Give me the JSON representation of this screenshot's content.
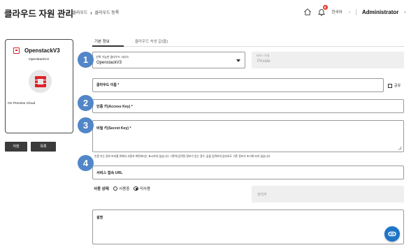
{
  "header": {
    "title": "클라우드 자원 관리",
    "breadcrumb": [
      "클라우드",
      "클라우드 등록"
    ],
    "notification_count": "6",
    "language": "한국어",
    "user": "Administrator",
    "icons": [
      "home-icon",
      "bell-icon",
      "chevron-down-icon"
    ]
  },
  "card": {
    "title": "OpenstackV3",
    "subtitle": "OpenstackV3",
    "type": "On Premise Cloud",
    "logo": "openstack-logo"
  },
  "actions": {
    "save": "저장",
    "list": "목록"
  },
  "tabs": [
    {
      "label": "기본 정보",
      "active": true
    },
    {
      "label": "클라우드 속성 값(들)",
      "active": false
    }
  ],
  "form": {
    "service_label": "선택 가능한 클라우드 서비스",
    "service_value": "OpenstackV3",
    "service_type_label": "서비스 유형",
    "service_type_value": "Private",
    "cloud_name_label": "클라우드 이름 *",
    "share_label": "공유",
    "access_key_label": "인증 키(Access Key) *",
    "secret_key_label": "비밀 키(Secret Key) *",
    "key_hint": "인증 키는 정보 보호를 위해서 사용자 화면에서는 표시하지 않습니다. 기존에 입력된 정보가 있는 경우, 값을 입력하지 않더라도 기존 정보가 초기화 되지 않습니다.",
    "service_url_label": "서비스 접속 URL",
    "status_label": "사용 상태",
    "status_options": [
      "사용중",
      "미사용"
    ],
    "status_selected": "미사용",
    "manager_label": "관리자",
    "description_label": "설명"
  },
  "steps": [
    "1",
    "2",
    "3",
    "4"
  ],
  "colors": {
    "step_badge": "#5186c8",
    "fab": "#1e75c8",
    "openstack_red": "#e0222a",
    "notification": "#e5402b"
  }
}
